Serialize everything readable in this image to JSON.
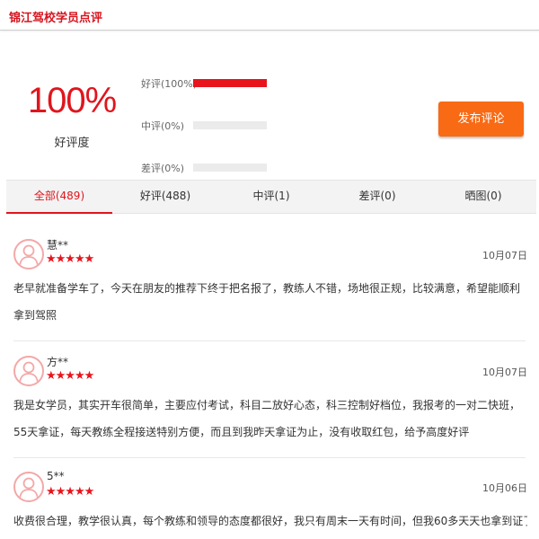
{
  "header": {
    "title": "锦江驾校学员点评"
  },
  "summary": {
    "score": "100%",
    "score_label": "好评度",
    "ratings": [
      {
        "label": "好评(100%)",
        "percent": 100
      },
      {
        "label": "中评(0%)",
        "percent": 0
      },
      {
        "label": "差评(0%)",
        "percent": 0
      }
    ],
    "publish_label": "发布评论"
  },
  "tabs": [
    {
      "label": "全部(489)",
      "active": true
    },
    {
      "label": "好评(488)",
      "active": false
    },
    {
      "label": "中评(1)",
      "active": false
    },
    {
      "label": "差评(0)",
      "active": false
    },
    {
      "label": "晒图(0)",
      "active": false
    }
  ],
  "reviews": [
    {
      "name": "慧**",
      "stars": "★★★★★",
      "date": "10月07日",
      "text": "老早就准备学车了，今天在朋友的推荐下终于把名报了，教练人不错，场地很正规，比较满意，希望能顺利拿到驾照"
    },
    {
      "name": "方**",
      "stars": "★★★★★",
      "date": "10月07日",
      "text": "我是女学员，其实开车很简单，主要应付考试，科目二放好心态，科三控制好档位，我报考的一对二快班，55天拿证，每天教练全程接送特别方便，而且到我昨天拿证为止，没有收取红包，给予高度好评"
    },
    {
      "name": "5**",
      "stars": "★★★★★",
      "date": "10月06日",
      "text": "收费很合理，教学很认真，每个教练和领导的态度都很好，我只有周末一天有时间，但我60多天天也拿到证了，"
    }
  ],
  "colors": {
    "brand_red": "#e0151d",
    "button_orange": "#f96a14"
  }
}
